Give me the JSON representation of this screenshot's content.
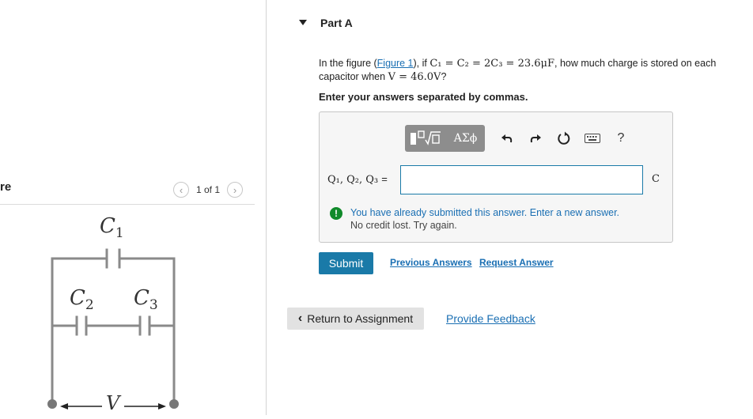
{
  "figure_panel": {
    "label_fragment": "re",
    "pager_text": "1 of 1",
    "circuit_labels": {
      "c1": "1",
      "c2": "2",
      "c3": "3",
      "voltage": "V",
      "c_letter": "C"
    }
  },
  "part": {
    "title": "Part A"
  },
  "question": {
    "prefix": "In the figure (",
    "figure_link": "Figure 1",
    "mid": "), if ",
    "math_condition": "C₁ = C₂ = 2C₃ = 23.6μF",
    "suffix": ", how much charge is stored on each capacitor when ",
    "math_voltage": "V = 46.0V",
    "end": "?"
  },
  "instructions": "Enter your answers separated by commas.",
  "answer": {
    "label": "Q₁, Q₂, Q₃",
    "equals": "=",
    "value": "",
    "unit": "C",
    "toolbar": {
      "symbols_label": "ΑΣϕ",
      "help_label": "?"
    }
  },
  "feedback": {
    "icon": "!",
    "line1": "You have already submitted this answer. Enter a new answer.",
    "line2": "No credit lost. Try again."
  },
  "actions": {
    "submit": "Submit",
    "previous_answers": "Previous Answers",
    "request_answer": "Request Answer",
    "return": "Return to Assignment",
    "provide_feedback": "Provide Feedback"
  },
  "colors": {
    "accent": "#1a7aa8",
    "link": "#1a6fb3",
    "success": "#108a2a"
  }
}
